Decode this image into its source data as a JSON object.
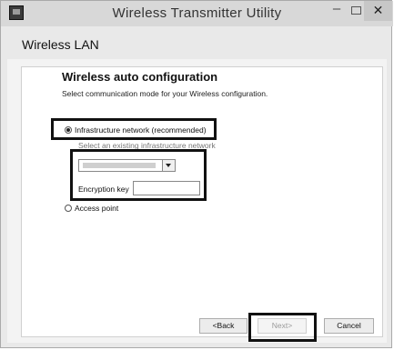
{
  "window": {
    "title": "Wireless Transmitter Utility",
    "min_symbol": "–",
    "close_symbol": "✕"
  },
  "header": {
    "title": "Wireless LAN"
  },
  "main": {
    "section_title": "Wireless auto configuration",
    "subtitle": "Select communication mode for your Wireless configuration.",
    "infrastructure_label": "Infrastructure network (recommended)",
    "network_select_label": "Select an existing infrastructure network",
    "encryption_label": "Encryption key",
    "encryption_value": "",
    "access_point_label": "Access point",
    "selected_mode": "Infrastructure network (recommended)"
  },
  "footer": {
    "back_label": "<Back",
    "next_label": "Next>",
    "cancel_label": "Cancel"
  },
  "colors": {
    "highlight_box": "#111111",
    "window_bg": "#e9e9e9"
  }
}
